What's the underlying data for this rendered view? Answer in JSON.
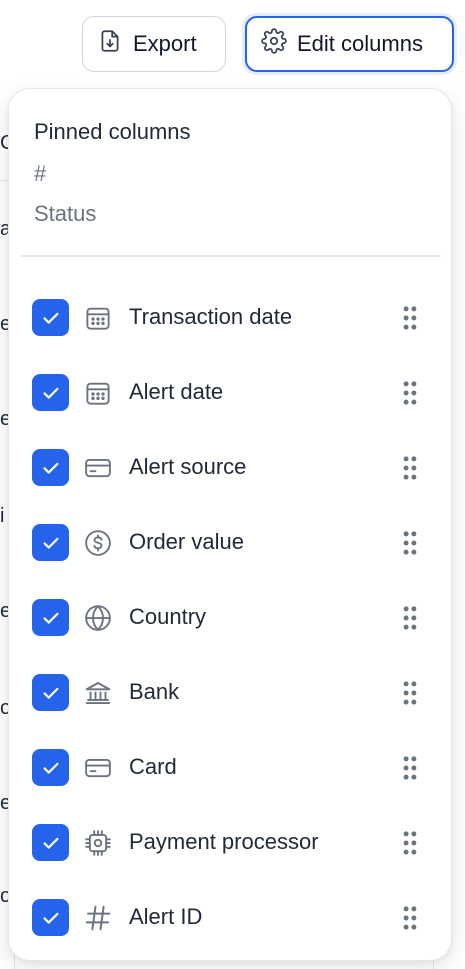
{
  "toolbar": {
    "export_label": "Export",
    "edit_columns_label": "Edit columns"
  },
  "background_fragments": [
    "C",
    "a",
    "e",
    "e",
    "i",
    "e",
    "o",
    "e",
    "o"
  ],
  "panel": {
    "pinned_title": "Pinned columns",
    "pinned_items": [
      "#",
      "Status"
    ],
    "columns": [
      {
        "label": "Transaction date",
        "icon": "calendar-icon",
        "checked": true
      },
      {
        "label": "Alert date",
        "icon": "calendar-icon",
        "checked": true
      },
      {
        "label": "Alert source",
        "icon": "credit-card-icon",
        "checked": true
      },
      {
        "label": "Order value",
        "icon": "dollar-circle-icon",
        "checked": true
      },
      {
        "label": "Country",
        "icon": "globe-icon",
        "checked": true
      },
      {
        "label": "Bank",
        "icon": "bank-icon",
        "checked": true
      },
      {
        "label": "Card",
        "icon": "credit-card-icon",
        "checked": true
      },
      {
        "label": "Payment processor",
        "icon": "chip-icon",
        "checked": true
      },
      {
        "label": "Alert ID",
        "icon": "hash-icon",
        "checked": true
      }
    ]
  },
  "colors": {
    "accent": "#2563eb",
    "icon_gray": "#6b7280",
    "text": "#1f2937",
    "muted": "#6b7280"
  }
}
